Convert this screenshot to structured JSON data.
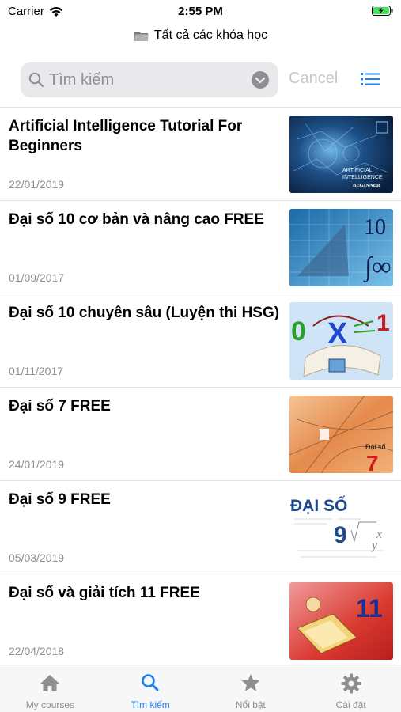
{
  "status": {
    "carrier": "Carrier",
    "time": "2:55 PM"
  },
  "nav": {
    "title": "Tất cả các khóa học"
  },
  "search": {
    "placeholder": "Tìm kiếm",
    "cancel": "Cancel"
  },
  "courses": [
    {
      "title": "Artificial Intelligence Tutorial For Beginners",
      "date": "22/01/2019",
      "thumb_text": [
        "ARTIFICIAL",
        "INTELLIGENCE",
        "BEGINNER"
      ]
    },
    {
      "title": "Đại số 10 cơ bản và nâng cao FREE",
      "date": "01/09/2017",
      "thumb_text": [
        "10"
      ]
    },
    {
      "title": "Đại số 10 chuyên sâu (Luyện thi HSG)",
      "date": "01/11/2017",
      "thumb_text": [
        "0",
        "X",
        "1"
      ]
    },
    {
      "title": "Đại số 7 FREE",
      "date": "24/01/2019",
      "thumb_text": [
        "Đại số",
        "7"
      ]
    },
    {
      "title": "Đại số 9 FREE",
      "date": "05/03/2019",
      "thumb_text": [
        "ĐẠI SỐ",
        "9"
      ]
    },
    {
      "title": "Đại số và giải tích 11 FREE",
      "date": "22/04/2018",
      "thumb_text": [
        "11"
      ]
    }
  ],
  "tabs": [
    {
      "label": "My courses",
      "icon": "home-icon"
    },
    {
      "label": "Tìm kiếm",
      "icon": "search-icon"
    },
    {
      "label": "Nổi bật",
      "icon": "star-icon"
    },
    {
      "label": "Cài đặt",
      "icon": "gear-icon"
    }
  ],
  "colors": {
    "accent": "#1f7ef5",
    "inactive": "#8e8e93",
    "battery": "#4cd964"
  }
}
